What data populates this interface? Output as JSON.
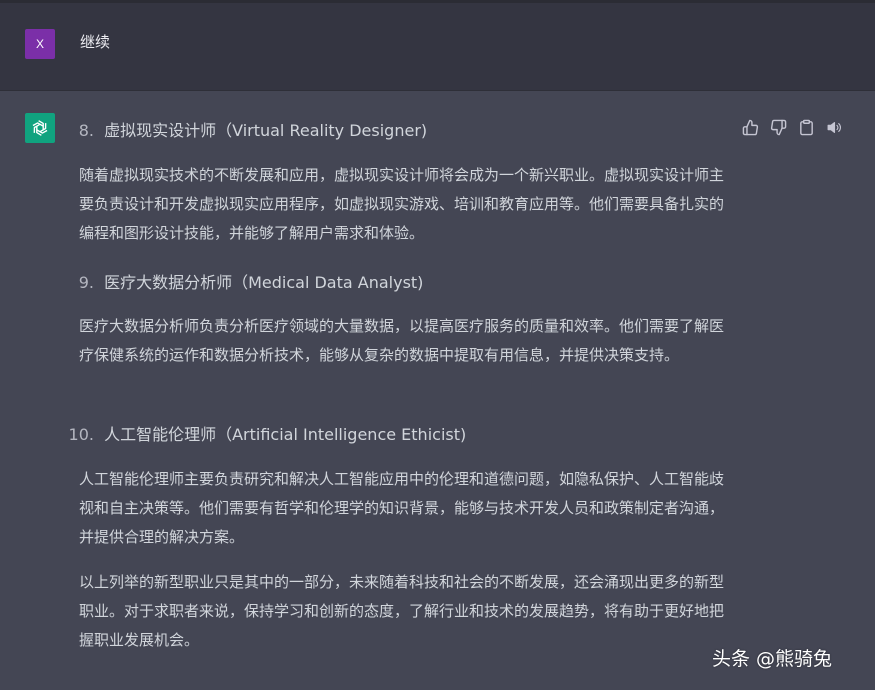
{
  "user_message": {
    "avatar_letter": "X",
    "avatar_color": "#7b2fa8",
    "text": "继续"
  },
  "assistant_message": {
    "avatar_color": "#10a37f",
    "avatar_icon": "openai-logo-icon",
    "actions": [
      {
        "icon": "thumbs-up-icon"
      },
      {
        "icon": "thumbs-down-icon"
      },
      {
        "icon": "clipboard-icon"
      },
      {
        "icon": "speaker-icon"
      }
    ],
    "items": [
      {
        "number": "8.",
        "title": "虚拟现实设计师（Virtual Reality Designer)",
        "paragraph": "随着虚拟现实技术的不断发展和应用，虚拟现实设计师将会成为一个新兴职业。虚拟现实设计师主要负责设计和开发虚拟现实应用程序，如虚拟现实游戏、培训和教育应用等。他们需要具备扎实的编程和图形设计技能，并能够了解用户需求和体验。"
      },
      {
        "number": "9.",
        "title": "医疗大数据分析师（Medical Data Analyst)",
        "paragraph": "医疗大数据分析师负责分析医疗领域的大量数据，以提高医疗服务的质量和效率。他们需要了解医疗保健系统的运作和数据分析技术，能够从复杂的数据中提取有用信息，并提供决策支持。"
      },
      {
        "number": "10.",
        "title": "人工智能伦理师（Artificial Intelligence Ethicist)",
        "paragraph": "人工智能伦理师主要负责研究和解决人工智能应用中的伦理和道德问题，如隐私保护、人工智能歧视和自主决策等。他们需要有哲学和伦理学的知识背景，能够与技术开发人员和政策制定者沟通，并提供合理的解决方案。"
      }
    ],
    "conclusion": "以上列举的新型职业只是其中的一部分，未来随着科技和社会的不断发展，还会涌现出更多的新型职业。对于求职者来说，保持学习和创新的态度，了解行业和技术的发展趋势，将有助于更好地把握职业发展机会。"
  },
  "watermark": "头条 @熊骑兔"
}
